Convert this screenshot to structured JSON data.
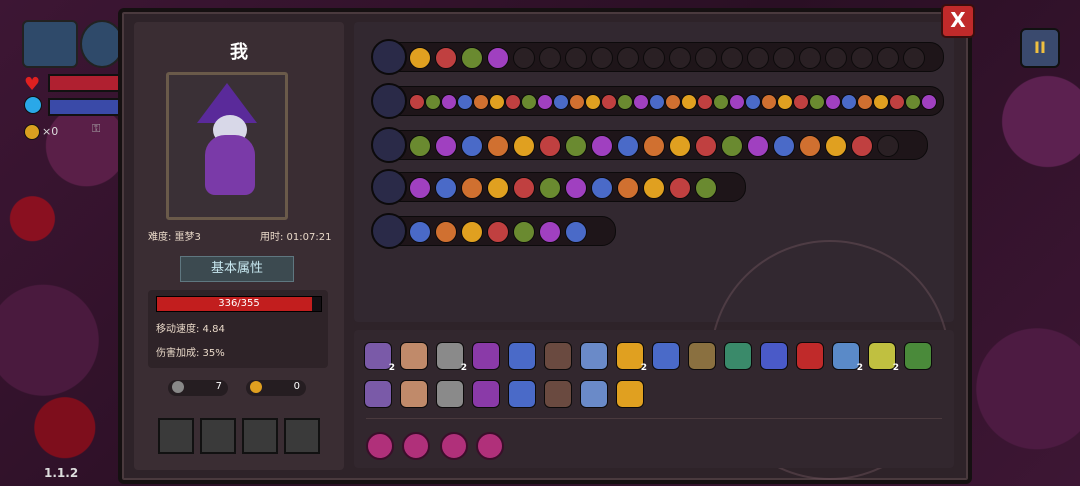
{
  "hud": {
    "coins": "×0",
    "version": "1.1.2",
    "pause_label": "II"
  },
  "player": {
    "name": "我",
    "difficulty": "难度: 噩梦3",
    "time": "用时: 01:07:21",
    "attr_title": "基本属性",
    "hp_text": "336/355",
    "hp_fraction": 0.946,
    "move_speed": "移动速度: 4.84",
    "damage_bonus": "伤害加成: 35%",
    "keys": "7",
    "gold": "0"
  },
  "close_label": "X",
  "rows": [
    {
      "name": "passive-row",
      "slots": 24,
      "filled": 4
    },
    {
      "name": "weapon-1",
      "slots": 33,
      "filled": 33
    },
    {
      "name": "weapon-2",
      "slots": 20,
      "filled": 18
    },
    {
      "name": "weapon-3",
      "slots": 13,
      "filled": 12
    },
    {
      "name": "weapon-4",
      "slots": 8,
      "filled": 8
    }
  ],
  "inventory": [
    {
      "badge": "2"
    },
    {
      "badge": ""
    },
    {
      "badge": "2"
    },
    {
      "badge": ""
    },
    {
      "badge": ""
    },
    {
      "badge": ""
    },
    {
      "badge": ""
    },
    {
      "badge": "2"
    },
    {
      "badge": ""
    },
    {
      "badge": ""
    },
    {
      "badge": ""
    },
    {
      "badge": ""
    },
    {
      "badge": ""
    },
    {
      "badge": "2"
    },
    {
      "badge": "2"
    },
    {
      "badge": ""
    },
    {
      "badge": ""
    },
    {
      "badge": ""
    },
    {
      "badge": ""
    },
    {
      "badge": ""
    },
    {
      "badge": ""
    },
    {
      "badge": ""
    },
    {
      "badge": ""
    },
    {
      "badge": ""
    }
  ],
  "colors": {
    "accent_gold": "#e0a020",
    "hp_red": "#c21e1e",
    "orb_pink": "#b0307a"
  }
}
